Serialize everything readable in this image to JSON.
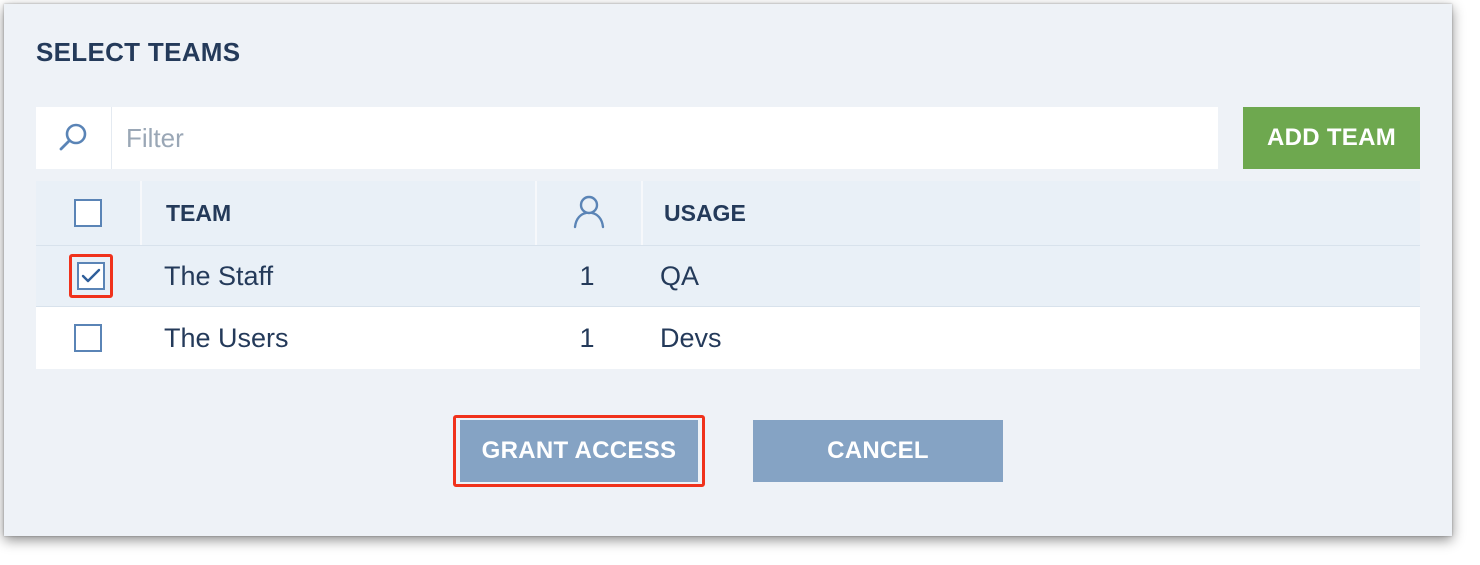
{
  "dialog": {
    "title": "SELECT TEAMS"
  },
  "filter": {
    "icon": "search-icon",
    "placeholder": "Filter",
    "value": ""
  },
  "add_team_label": "ADD TEAM",
  "table": {
    "columns": {
      "team": "TEAM",
      "members_icon": "user-icon",
      "usage": "USAGE"
    },
    "rows": [
      {
        "team": "The Staff",
        "count": "1",
        "usage": "QA",
        "checked": true
      },
      {
        "team": "The Users",
        "count": "1",
        "usage": "Devs",
        "checked": false
      }
    ]
  },
  "buttons": {
    "grant": "GRANT ACCESS",
    "cancel": "CANCEL"
  },
  "colors": {
    "accent_green": "#6ea84f",
    "button_blue": "#85a3c4",
    "highlight_red": "#f0321c",
    "text_navy": "#243a5a"
  }
}
